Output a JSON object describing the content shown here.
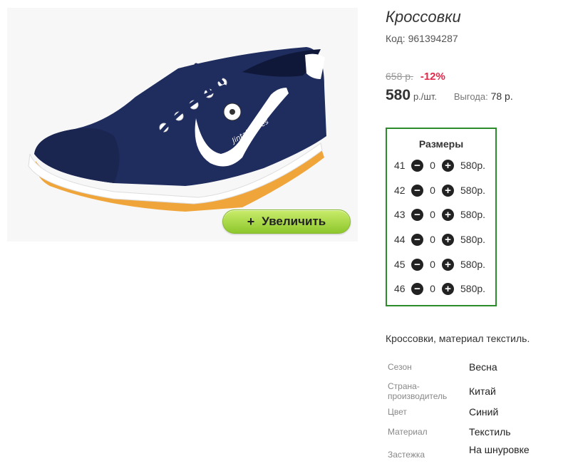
{
  "product": {
    "title": "Кроссовки",
    "code": "Код: 961394287",
    "image_alt": "Jintai shoes"
  },
  "zoom_button": {
    "icon": "plus-icon",
    "label": "Увеличить"
  },
  "pricing": {
    "old_price": "658 р.",
    "discount": "-12%",
    "price": "580",
    "unit": "р./шт.",
    "benefit_label": "Выгода:",
    "benefit_value": "78 р."
  },
  "sizes": {
    "title": "Размеры",
    "minus_icon": "minus-circle-icon",
    "plus_icon": "plus-circle-icon",
    "rows": [
      {
        "size": "41",
        "qty": "0",
        "price": "580р."
      },
      {
        "size": "42",
        "qty": "0",
        "price": "580р."
      },
      {
        "size": "43",
        "qty": "0",
        "price": "580р."
      },
      {
        "size": "44",
        "qty": "0",
        "price": "580р."
      },
      {
        "size": "45",
        "qty": "0",
        "price": "580р."
      },
      {
        "size": "46",
        "qty": "0",
        "price": "580р."
      }
    ]
  },
  "description": "Кроссовки, материал текстиль.",
  "properties": [
    {
      "label": "Сезон",
      "value": "Весна"
    },
    {
      "label": "Страна-производитель",
      "value": "Китай"
    },
    {
      "label": "Цвет",
      "value": "Синий"
    },
    {
      "label": "Материал",
      "value": "Текстиль"
    },
    {
      "label": "Застежка",
      "value": "На шнуровке"
    }
  ],
  "colors": {
    "sizes_border": "#2c8c2c",
    "discount": "#e0294a",
    "zoom_button": "#a6d943",
    "shoe_body": "#1f2c5e",
    "sole": "#f0a53a"
  }
}
